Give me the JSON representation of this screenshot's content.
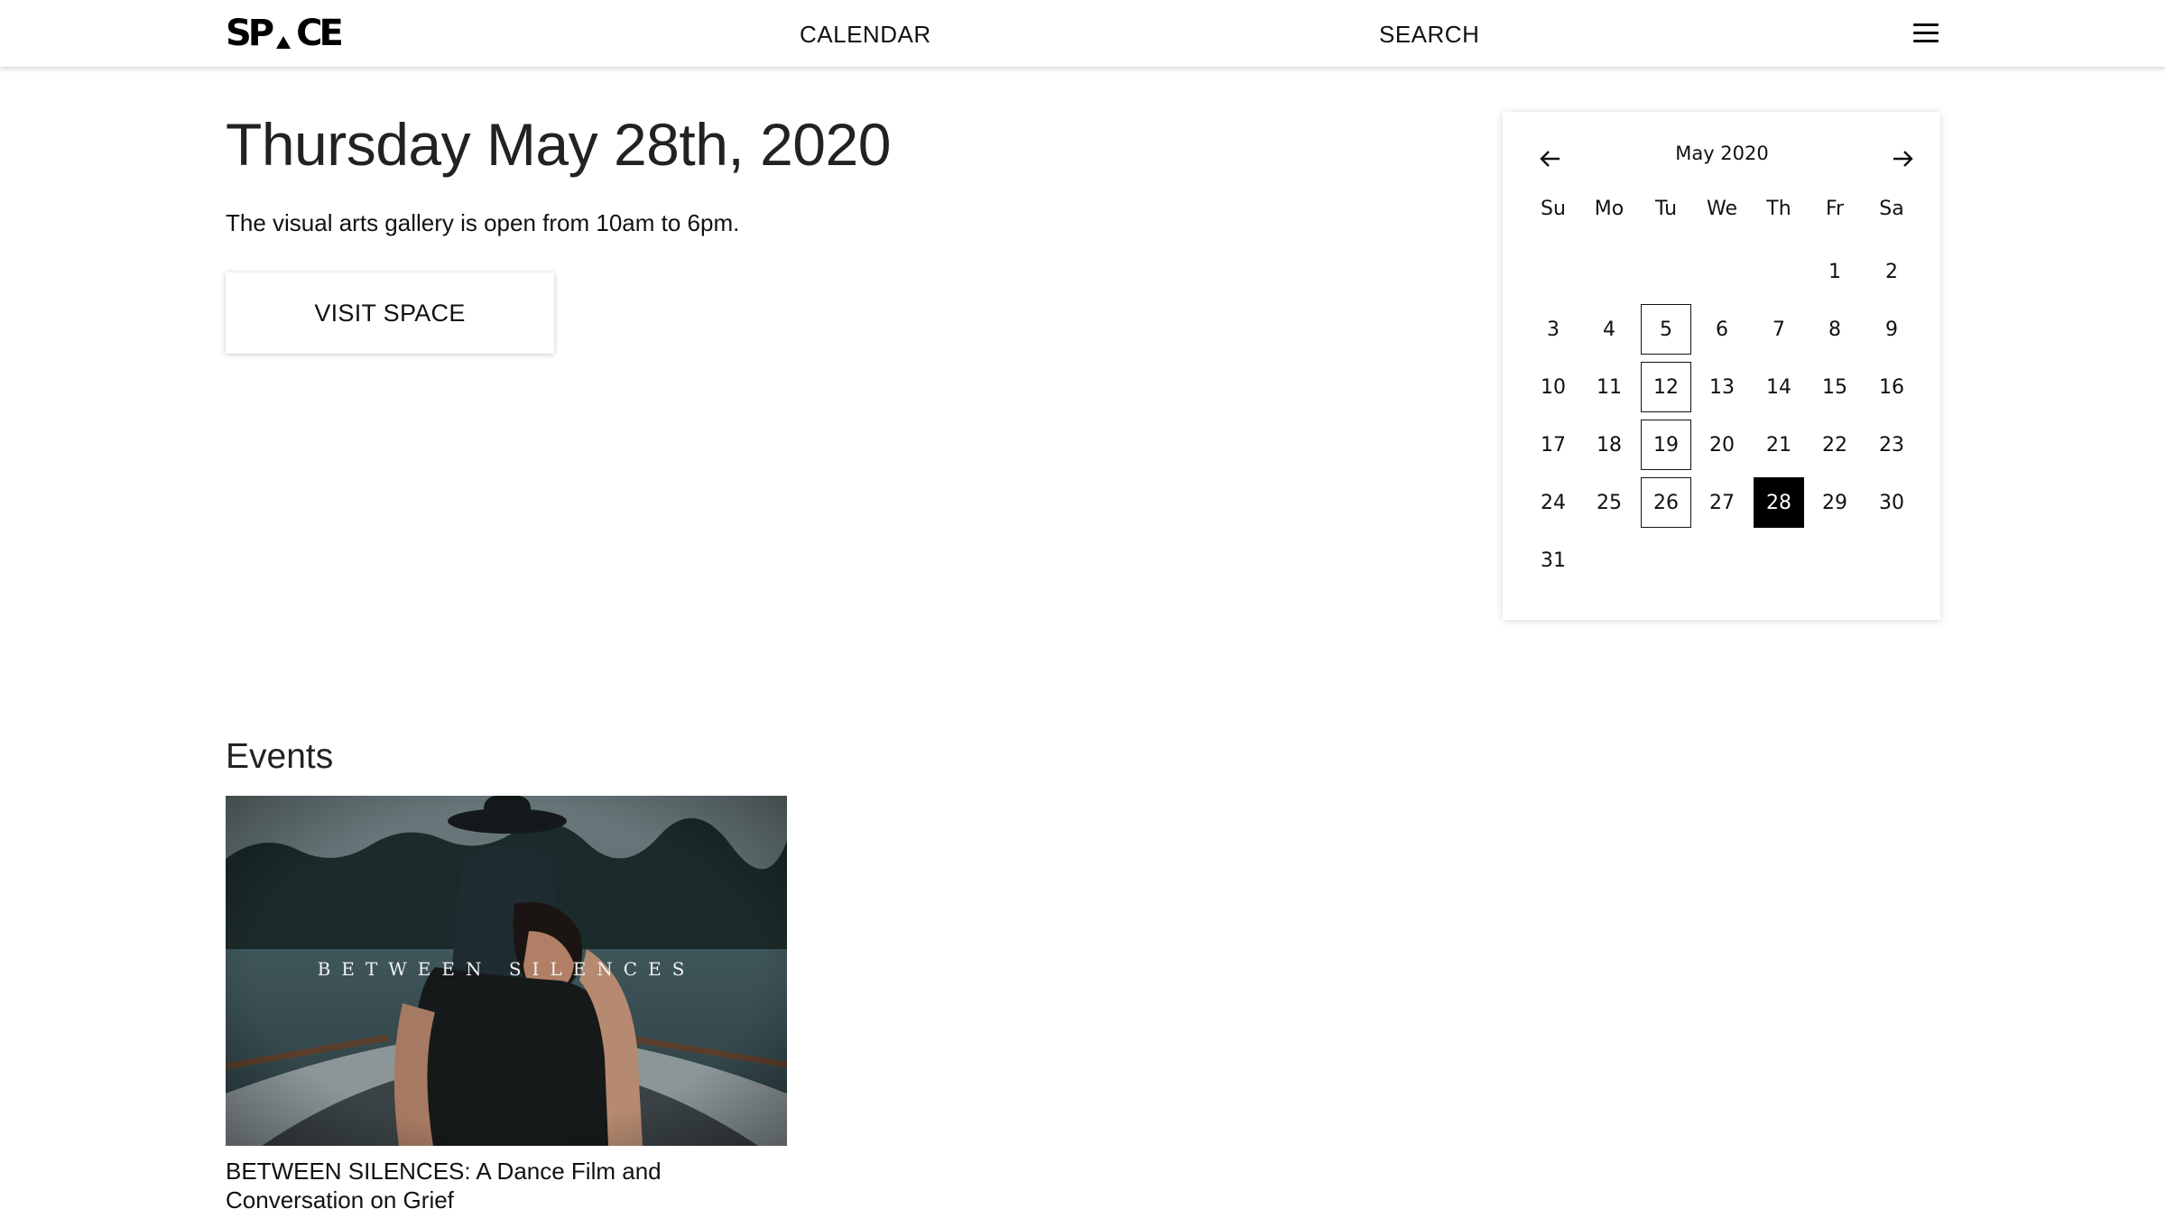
{
  "header": {
    "logo_left": "SP",
    "logo_right": "CE",
    "nav": {
      "calendar": "CALENDAR",
      "search": "SEARCH"
    }
  },
  "day": {
    "title": "Thursday May 28th, 2020",
    "hours": "The visual arts gallery is open from 10am to 6pm.",
    "visit_label": "VISIT SPACE"
  },
  "calendar": {
    "month_label": "May 2020",
    "weekdays": [
      "Su",
      "Mo",
      "Tu",
      "We",
      "Th",
      "Fr",
      "Sa"
    ],
    "first_weekday_index": 5,
    "days_in_month": 31,
    "event_days": [
      5,
      12,
      19,
      26
    ],
    "selected_day": 28
  },
  "events": {
    "heading": "Events",
    "items": [
      {
        "image_text": "BETWEEN SILENCES",
        "title": "BETWEEN SILENCES: A Dance Film and Conversation on Grief"
      }
    ]
  },
  "colors": {
    "text": "#111111",
    "selected_bg": "#000000",
    "selected_text": "#ffffff",
    "image_water": "#3d5358"
  }
}
